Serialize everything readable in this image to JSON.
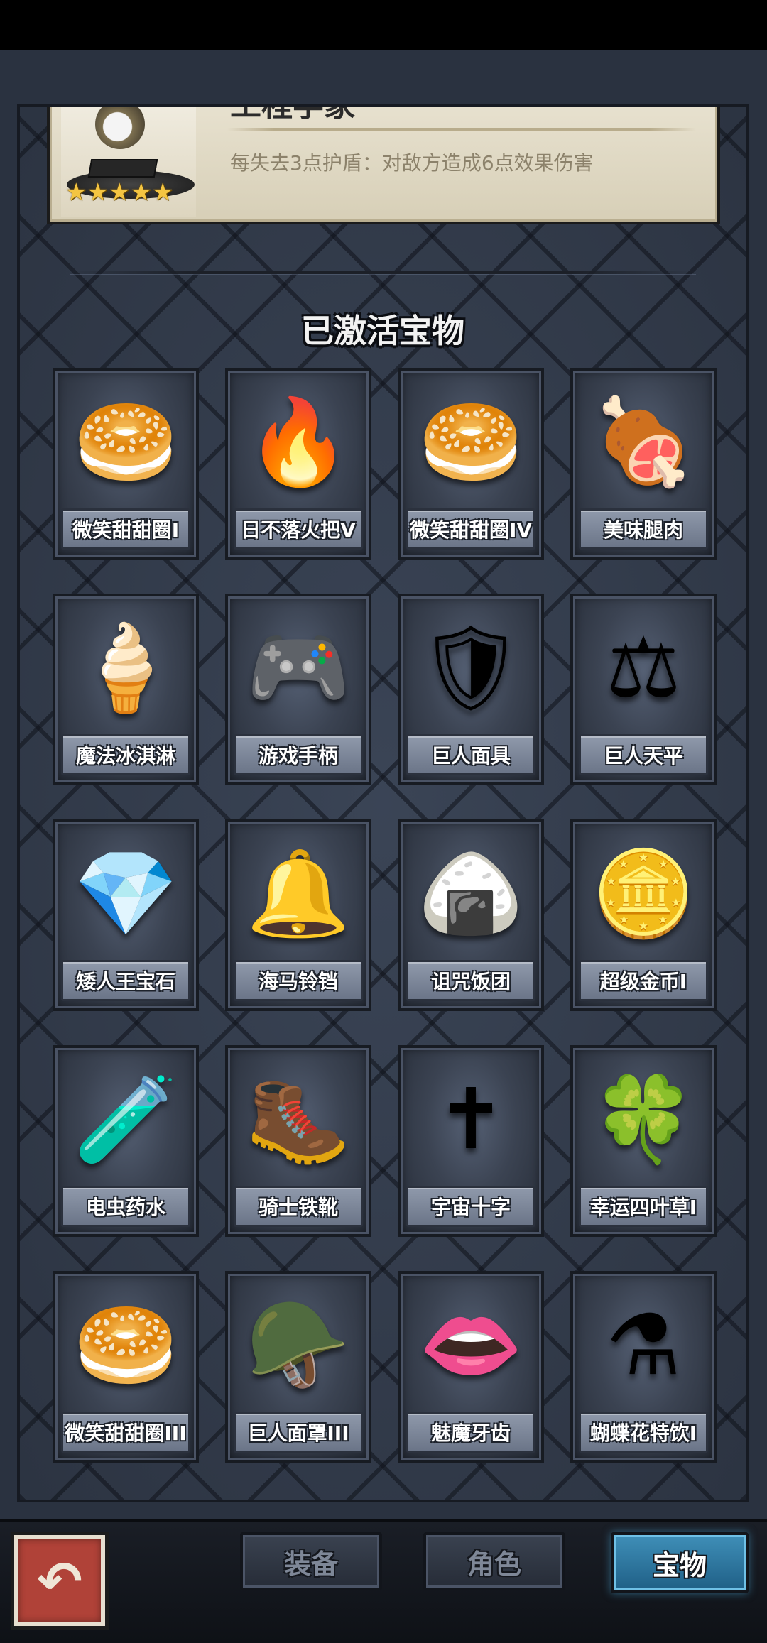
{
  "character": {
    "name": "工程学家",
    "stars": "★★★★★",
    "description": "每失去3点护盾：对敌方造成6点效果伤害"
  },
  "section_title": "已激活宝物",
  "treasures": [
    {
      "name": "微笑甜甜圈I",
      "icon": "donut-icon",
      "glyph": "🥯"
    },
    {
      "name": "日不落火把V",
      "icon": "torch-icon",
      "glyph": "🔥"
    },
    {
      "name": "微笑甜甜圈IV",
      "icon": "donut-icon",
      "glyph": "🥯"
    },
    {
      "name": "美味腿肉",
      "icon": "meat-leg-icon",
      "glyph": "🍖"
    },
    {
      "name": "魔法冰淇淋",
      "icon": "ice-cream-icon",
      "glyph": "🍦"
    },
    {
      "name": "游戏手柄",
      "icon": "gamepad-icon",
      "glyph": "🎮"
    },
    {
      "name": "巨人面具",
      "icon": "mask-icon",
      "glyph": "🛡"
    },
    {
      "name": "巨人天平",
      "icon": "scales-icon",
      "glyph": "⚖"
    },
    {
      "name": "矮人王宝石",
      "icon": "gem-icon",
      "glyph": "💎"
    },
    {
      "name": "海马铃铛",
      "icon": "bell-icon",
      "glyph": "🔔"
    },
    {
      "name": "诅咒饭团",
      "icon": "rice-ball-icon",
      "glyph": "🍙"
    },
    {
      "name": "超级金币I",
      "icon": "coin-icon",
      "glyph": "🪙"
    },
    {
      "name": "电虫药水",
      "icon": "potion-tube-icon",
      "glyph": "🧪"
    },
    {
      "name": "骑士铁靴",
      "icon": "boots-icon",
      "glyph": "🥾"
    },
    {
      "name": "宇宙十字",
      "icon": "cross-icon",
      "glyph": "✝"
    },
    {
      "name": "幸运四叶草I",
      "icon": "clover-icon",
      "glyph": "🍀"
    },
    {
      "name": "微笑甜甜圈III",
      "icon": "donut-icon",
      "glyph": "🥯"
    },
    {
      "name": "巨人面罩III",
      "icon": "face-guard-icon",
      "glyph": "🪖"
    },
    {
      "name": "魅魔牙齿",
      "icon": "lips-fangs-icon",
      "glyph": "👄"
    },
    {
      "name": "蝴蝶花特饮I",
      "icon": "potion-flask-icon",
      "glyph": "⚗"
    }
  ],
  "nav": {
    "back_glyph": "↶",
    "tabs": [
      {
        "label": "装备",
        "active": false
      },
      {
        "label": "角色",
        "active": false
      },
      {
        "label": "宝物",
        "active": true
      }
    ]
  },
  "colors": {
    "panel": "#343d4d",
    "active_tab": "#2f7aa6",
    "back_button": "#b04238",
    "star": "#f4c542"
  }
}
